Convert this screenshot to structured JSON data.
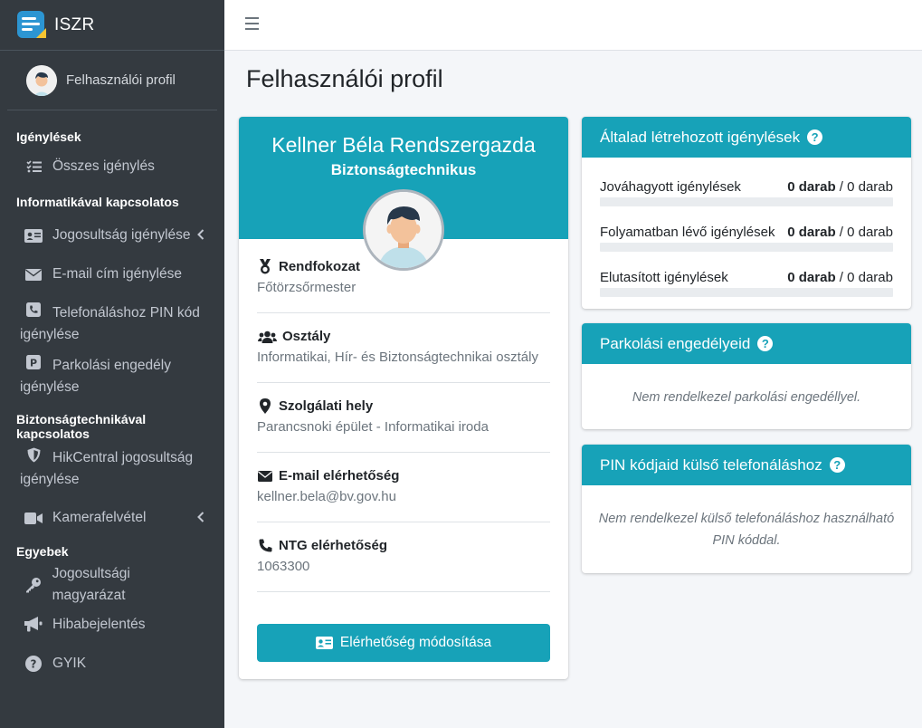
{
  "brand": {
    "title": "ISZR"
  },
  "user_panel": {
    "name": "Felhasználói profil"
  },
  "nav": {
    "sections": [
      {
        "header": "Igénylések"
      },
      {
        "header": "Informatikával kapcsolatos"
      },
      {
        "header": "Biztonságtechnikával kapcsolatos"
      },
      {
        "header": "Egyebek"
      }
    ],
    "items": {
      "all_requests": "Összes igénylés",
      "permission_request": "Jogosultság igénylése",
      "email_request": "E-mail cím igénylése",
      "phone_pin_line1": "Telefonáláshoz PIN kód",
      "phone_pin_line2": "igénylése",
      "parking_line1": "Parkolási engedély",
      "parking_line2": "igénylése",
      "hikcentral_line1": "HikCentral jogosultság",
      "hikcentral_line2": "igénylése",
      "camera": "Kamerafelvétel",
      "permission_explain": "Jogosultsági magyarázat",
      "bug_report": "Hibabejelentés",
      "faq": "GYIK"
    }
  },
  "page": {
    "title": "Felhasználói profil"
  },
  "profile": {
    "name": "Kellner Béla Rendszergazda",
    "role": "Biztonságtechnikus",
    "fields": [
      {
        "label": "Rendfokozat",
        "value": "Főtörzsőrmester"
      },
      {
        "label": "Osztály",
        "value": "Informatikai, Hír- és Biztonságtechnikai osztály"
      },
      {
        "label": "Szolgálati hely",
        "value": "Parancsnoki épület - Informatikai iroda"
      },
      {
        "label": "E-mail elérhetőség",
        "value": "kellner.bela@bv.gov.hu"
      },
      {
        "label": "NTG elérhetőség",
        "value": "1063300"
      }
    ],
    "edit_button": "Elérhetőség módosítása"
  },
  "requests_card": {
    "title": "Általad létrehozott igénylések",
    "help": "?",
    "rows": [
      {
        "label": "Jováhagyott igénylések",
        "count": "0 darab",
        "total": "/ 0 darab",
        "progress": 0
      },
      {
        "label": "Folyamatban lévő igénylések",
        "count": "0 darab",
        "total": "/ 0 darab",
        "progress": 0
      },
      {
        "label": "Elutasított igénylések",
        "count": "0 darab",
        "total": "/ 0 darab",
        "progress": 0
      }
    ]
  },
  "parking_card": {
    "title": "Parkolási engedélyeid",
    "help": "?",
    "empty": "Nem rendelkezel parkolási engedéllyel."
  },
  "pin_card": {
    "title": "PIN kódjaid külső telefonáláshoz",
    "help": "?",
    "empty": "Nem rendelkezel külső telefonáláshoz használható PIN kóddal."
  },
  "colors": {
    "accent": "#17a2b8",
    "sidebar": "#343a40"
  }
}
